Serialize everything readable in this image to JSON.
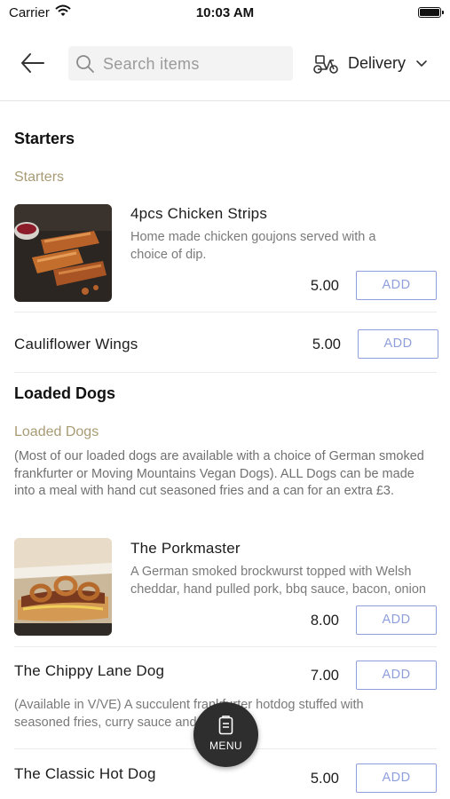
{
  "status_bar": {
    "carrier": "Carrier",
    "time": "10:03 AM"
  },
  "header": {
    "search_placeholder": "Search items",
    "delivery_label": "Delivery"
  },
  "sections": [
    {
      "title": "Starters",
      "category_label": "Starters",
      "items": [
        {
          "name": "4pcs Chicken Strips",
          "description": "Home made chicken goujons served with a choice of dip.",
          "price": "5.00",
          "add_label": "ADD"
        },
        {
          "name": "Cauliflower Wings",
          "price": "5.00",
          "add_label": "ADD"
        }
      ]
    },
    {
      "title": "Loaded Dogs",
      "category_label": "Loaded Dogs",
      "category_description": "(Most of our loaded dogs are available with a choice of German smoked frankfurter or Moving Mountains Vegan Dogs). ALL Dogs can be made into a meal with hand cut seasoned fries and a can for an extra £3.",
      "items": [
        {
          "name": "The Porkmaster",
          "description": "A German smoked brockwurst topped with Welsh cheddar, hand pulled pork, bbq sauce, bacon, onion rings",
          "price": "8.00",
          "add_label": "ADD"
        },
        {
          "name": "The Chippy Lane Dog",
          "description": "(Available in V/VE) A succulent frankfurter hotdog stuffed with seasoned fries, curry sauce and chips.",
          "price": "7.00",
          "add_label": "ADD"
        },
        {
          "name": "The Classic Hot Dog",
          "price": "5.00",
          "add_label": "ADD"
        }
      ]
    }
  ],
  "fab": {
    "label": "MENU"
  },
  "colors": {
    "accent": "#8f9fdc",
    "category": "#a89b74",
    "fab_bg": "#2e2e2e"
  }
}
